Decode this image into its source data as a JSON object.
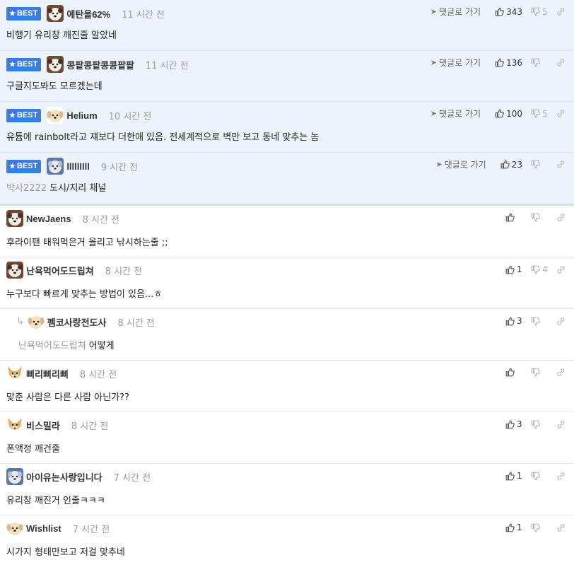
{
  "labels": {
    "best": "BEST",
    "goto": "댓글로 가기"
  },
  "colors": {
    "best_bg": "#eef3fb",
    "badge": "#3b7ddd",
    "muted": "#9a9a9a"
  },
  "best_comments": [
    {
      "nick": "에탄올62%",
      "time": "11 시간 전",
      "body": "비행기 유리창 깨진줄 알았네",
      "up": "343",
      "down": "5",
      "avatar": "dog-brown-icon"
    },
    {
      "nick": "콩팥콩팥콩콩팥팥",
      "time": "11 시간 전",
      "body": "구글지도봐도 모르겠는데",
      "up": "136",
      "down": "",
      "avatar": "dog-brown-icon"
    },
    {
      "nick": "Helium",
      "time": "10 시간 전",
      "body": "유튭에 rainbolt라고 쟤보다 더한애 있음. 전세계적으로 벽만 보고 동네 맞추는 놈",
      "up": "100",
      "down": "5",
      "avatar": "dog-cream-icon"
    },
    {
      "nick": "lllllllll",
      "time": "9 시간 전",
      "mention": "박사2222",
      "body": "도시/지리 채널",
      "up": "23",
      "down": "",
      "avatar": "dog-grey-icon"
    }
  ],
  "comments": [
    {
      "nick": "NewJaens",
      "time": "8 시간 전",
      "body": "후라이팬 태워먹은거 올리고 낚시하는줄 ;;",
      "up": "",
      "down": "",
      "avatar": "dog-brown-icon",
      "reply": false
    },
    {
      "nick": "난욕먹어도드립쳐",
      "time": "8 시간 전",
      "body": "누구보다 빠르게 맞추는 방법이 있음...ㅎ",
      "up": "1",
      "down": "4",
      "avatar": "dog-brown-icon",
      "reply": false
    },
    {
      "nick": "펨코사랑전도사",
      "time": "8 시간 전",
      "mention": "난욕먹어도드립쳐",
      "body": "어떻게",
      "up": "3",
      "down": "",
      "avatar": "dog-cream-icon",
      "reply": true
    },
    {
      "nick": "삐리삐리삐",
      "time": "8 시간 전",
      "body": "맞춘 사람은 다른 사람 아닌가??",
      "up": "",
      "down": "",
      "avatar": "fox-icon",
      "reply": false
    },
    {
      "nick": "비스밀라",
      "time": "8 시간 전",
      "body": "폰액정 깨건줄",
      "up": "3",
      "down": "",
      "avatar": "fox-icon",
      "reply": false
    },
    {
      "nick": "아이유는사랑입니다",
      "time": "7 시간 전",
      "body": "유리창 깨진거 인줄ㅋㅋㅋ",
      "up": "1",
      "down": "",
      "avatar": "dog-grey-icon",
      "reply": false
    },
    {
      "nick": "Wishlist",
      "time": "7 시간 전",
      "body": "시가지 형태만보고 저걸 맞추네",
      "up": "1",
      "down": "",
      "avatar": "dog-cream-icon",
      "reply": false
    }
  ]
}
